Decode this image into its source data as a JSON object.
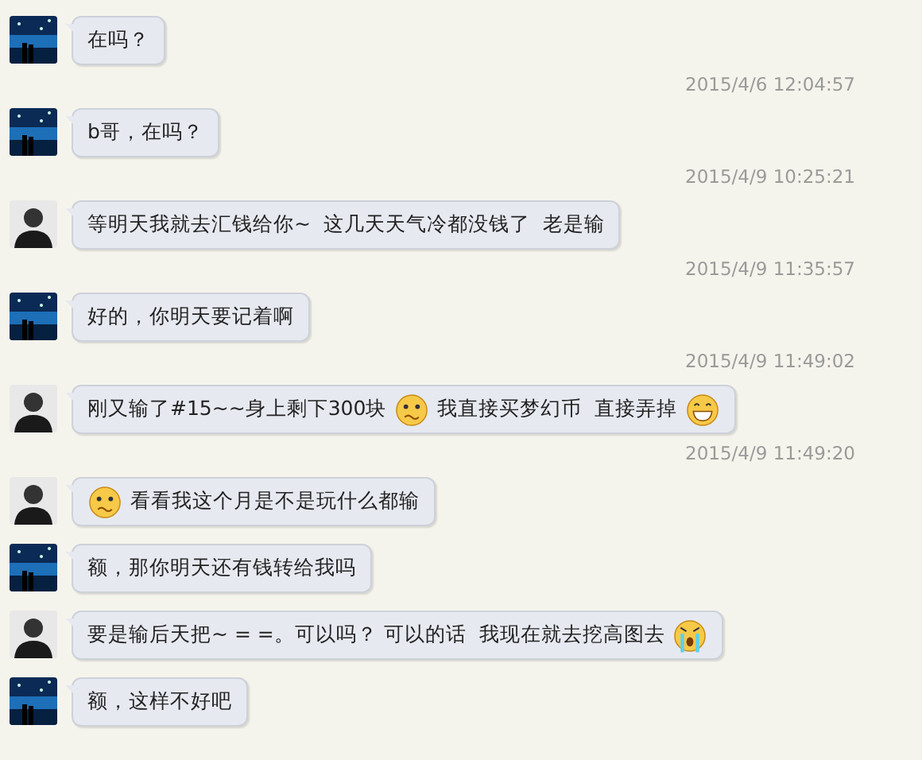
{
  "messages": [
    {
      "kind": "sky",
      "parts": [
        {
          "kind": "text",
          "text": "在吗？"
        }
      ]
    },
    {
      "timestamp": "2015/4/6 12:04:57",
      "kind": "sky",
      "parts": [
        {
          "kind": "text",
          "text": "b哥，在吗？"
        }
      ]
    },
    {
      "timestamp": "2015/4/9 10:25:21",
      "kind": "person",
      "parts": [
        {
          "kind": "text",
          "text": "等明天我就去汇钱给你~  这几天天气冷都没钱了  老是输"
        }
      ]
    },
    {
      "timestamp": "2015/4/9 11:35:57",
      "kind": "sky",
      "parts": [
        {
          "kind": "text",
          "text": "好的，你明天要记着啊"
        }
      ]
    },
    {
      "timestamp": "2015/4/9 11:49:02",
      "kind": "person",
      "parts": [
        {
          "kind": "text",
          "text": "刚又输了#15~~身上剩下300块"
        },
        {
          "kind": "worried"
        },
        {
          "kind": "text",
          "text": "我直接买梦幻币  直接弄掉"
        },
        {
          "kind": "grin"
        }
      ]
    },
    {
      "timestamp": "2015/4/9 11:49:20",
      "kind": "person",
      "parts": [
        {
          "kind": "worried"
        },
        {
          "kind": "text",
          "text": "看看我这个月是不是玩什么都输"
        }
      ]
    },
    {
      "kind": "sky",
      "parts": [
        {
          "kind": "text",
          "text": "额，那你明天还有钱转给我吗"
        }
      ]
    },
    {
      "kind": "person",
      "parts": [
        {
          "kind": "text",
          "text": "要是输后天把~ = =。可以吗？ 可以的话  我现在就去挖高图去"
        },
        {
          "kind": "cry"
        }
      ]
    },
    {
      "kind": "sky",
      "parts": [
        {
          "kind": "text",
          "text": "额，这样不好吧"
        }
      ]
    }
  ]
}
